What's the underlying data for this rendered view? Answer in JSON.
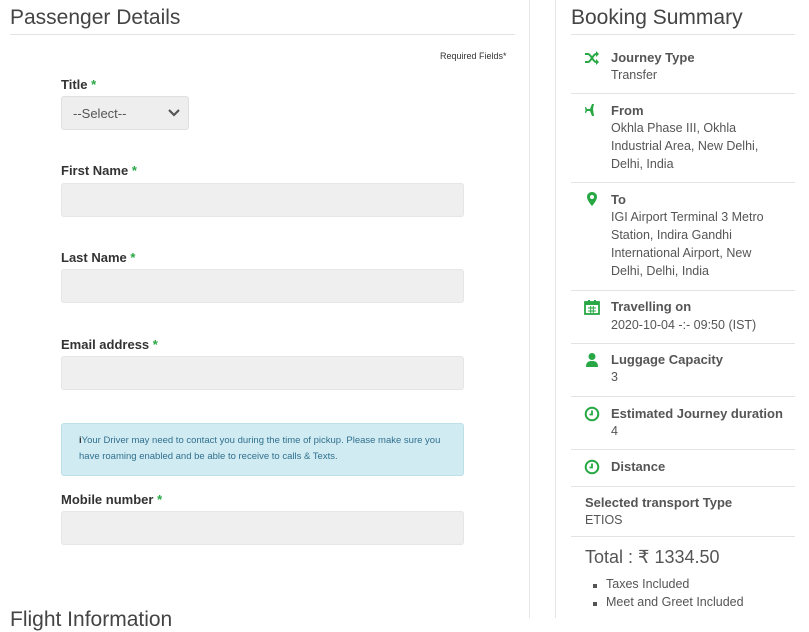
{
  "passenger": {
    "title": "Passenger Details",
    "required_note": "Required Fields*",
    "star": "*",
    "title_label": "Title",
    "title_select_value": "--Select--",
    "first_name_label": "First Name",
    "last_name_label": "Last Name",
    "email_label": "Email address",
    "info_icon": "i",
    "info_text": "Your Driver may need to contact you during the time of pickup. Please make sure you have roaming enabled and be able to receive to calls & Texts.",
    "mobile_label": "Mobile number",
    "next_heading": "Flight Information"
  },
  "summary": {
    "title": "Booking Summary",
    "items": [
      {
        "label": "Journey Type",
        "value": "Transfer",
        "icon": "shuffle-icon"
      },
      {
        "label": "From",
        "value": "Okhla Phase III, Okhla Industrial Area, New Delhi, Delhi, India",
        "icon": "plane-icon"
      },
      {
        "label": "To",
        "value": "IGI Airport Terminal 3 Metro Station, Indira Gandhi International Airport, New Delhi, Delhi, India",
        "icon": "map-pin-icon"
      },
      {
        "label": "Travelling on",
        "value": "2020-10-04 -:- 09:50 (IST)",
        "icon": "calendar-icon"
      },
      {
        "label": "Luggage Capacity",
        "value": "3",
        "icon": "user-icon"
      },
      {
        "label": "Estimated Journey duration",
        "value": "4",
        "icon": "clock-icon"
      },
      {
        "label": "Distance",
        "value": "",
        "icon": "clock-icon"
      }
    ],
    "transport_label": "Selected transport Type",
    "transport_value": "ETIOS",
    "total": "Total : ₹ 1334.50",
    "inclusions": [
      "Taxes Included",
      "Meet and Greet Included"
    ],
    "accent_color": "#27a844"
  }
}
